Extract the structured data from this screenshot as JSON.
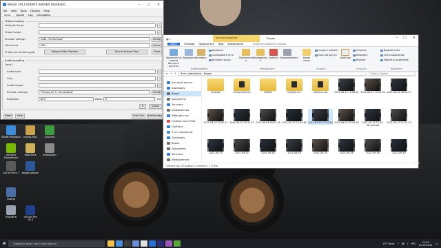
{
  "desktop_icons": [
    {
      "label": "AOMEI Partition",
      "color": "#3a8bdc"
    },
    {
      "label": "movie-files",
      "color": "#caa24b"
    },
    {
      "label": "uTorrent",
      "color": "#3f9b3f"
    },
    {
      "label": "GeForce Experience",
      "color": "#76b900"
    },
    {
      "label": "Mod-Files",
      "color": "#d0b25b"
    },
    {
      "label": "mdisplayer",
      "color": "#8a8a8a"
    },
    {
      "label": "Call of Duty 2",
      "color": "#5b5b5b"
    },
    {
      "label": "видео-ролик",
      "color": "#2b5797"
    },
    {
      "label": "Корзина",
      "color": "#9aa3ad"
    },
    {
      "label": "VEGAS Pro 18.0",
      "color": "#203f8a"
    },
    {
      "label": "ПоиНо",
      "color": "#4a6ea8"
    }
  ],
  "megui": {
    "title": "MeGUI 2913 UPDATE SERVER DISABLED",
    "menu": [
      "File",
      "View",
      "Tools",
      "Options",
      "Help"
    ],
    "tabs": [
      "Input",
      "Queue",
      "Log",
      "Changelog"
    ],
    "video_group": "Video encoding",
    "avisynth_label": "AviSynth Script",
    "video_output_label": "Video Output",
    "encoder_label": "Encoder settings",
    "encoder_value": "x264: *scratchpad*",
    "file_format_label": "File format",
    "file_format_value": "MKV",
    "add_prerender": "Add pre-rendering job",
    "reopen_btn": "Reopen Video Preview",
    "queue_btn": "Queue Analysis Pass",
    "config_btn": "Config",
    "queue_small": "Queue",
    "audio_group": "Audio encoding",
    "track_label": "Track 1",
    "audio_input_label": "Audio Input",
    "cuts_label": "Cuts",
    "audio_output_label": "Audio Output",
    "audio_encoder_value": "FFmpeg AC-3: *scratchpad*",
    "extension_label": "Extension",
    "extension_value": "AC3",
    "delay_label": "Delay",
    "delay_value": "0",
    "ms": "ms",
    "x_btn": "X",
    "reset_btn": "Reset",
    "help_btn": "Help",
    "oneclick_btn": "One-Click",
    "autoencode_btn": "AutoEncode"
  },
  "explorer": {
    "context_tab": "Воспроизведение",
    "context_title": "Средства работы с видео",
    "title": "Видео",
    "tabs": [
      "Файл",
      "Главная",
      "Поделиться",
      "Вид",
      "Управление"
    ],
    "ribbon": {
      "pin": "Закрепить на панели быстрого доступа",
      "copy": "Копировать",
      "paste": "Вставить",
      "cut": "Вырезать",
      "copy_path": "Скопировать путь",
      "paste_shortcut": "Вставить ярлык",
      "move": "Переместить в",
      "copy_to": "Копировать в",
      "delete": "Удалить",
      "rename": "Переименовать",
      "new_folder": "Новая папка",
      "new_item": "Создать элемент",
      "easy_access": "Простой доступ",
      "properties": "Свойства",
      "open": "Открыть",
      "change": "Изменить",
      "history": "Журнал",
      "select_all": "Выделить все",
      "select_none": "Снять выделение",
      "invert": "Обратить выделение",
      "g_clipboard": "Буфер обмена",
      "g_organize": "Упорядочить",
      "g_create": "Создать",
      "g_open": "Открыть",
      "g_select": "Выделить"
    },
    "address": "Этот компьютер  ›  Видео",
    "search_placeholder": "Поиск: Видео",
    "nav": [
      {
        "label": "Быстрый доступ",
        "color": "#2f7bd8"
      },
      {
        "label": "Downloads",
        "color": "#2f7bd8"
      },
      {
        "label": "Видео",
        "color": "#6d6d6d"
      },
      {
        "label": "Документы",
        "color": "#6d6d6d"
      },
      {
        "label": "Загрузки",
        "color": "#2f7bd8"
      },
      {
        "label": "Изображения",
        "color": "#6d6d6d"
      },
      {
        "label": "Рабочий стол",
        "color": "#2f7bd8"
      },
      {
        "label": "Creative Cloud Files",
        "color": "#e34850"
      },
      {
        "label": "OneDrive",
        "color": "#2f7bd8"
      },
      {
        "label": "Этот компьютер",
        "color": "#4a88c7"
      },
      {
        "label": "Downloads",
        "color": "#2f7bd8"
      },
      {
        "label": "Видео",
        "color": "#6d6d6d"
      },
      {
        "label": "Документы",
        "color": "#6d6d6d"
      },
      {
        "label": "Загрузки",
        "color": "#2f7bd8"
      },
      {
        "label": "Изображения",
        "color": "#6d6d6d"
      },
      {
        "label": "Музыка",
        "color": "#6d6d6d"
      },
      {
        "label": "Объемные объект",
        "color": "#6d6d6d"
      },
      {
        "label": "Рабочий стол",
        "color": "#2f7bd8"
      }
    ],
    "files_row1": [
      {
        "name": "AnyDesk",
        "kind": "folder"
      },
      {
        "name": "mehgcmud.xcs",
        "kind": "folder-film"
      },
      {
        "name": "NVIDIA",
        "kind": "folder"
      },
      {
        "name": "ufaej3D.vcx",
        "kind": "folder-film"
      },
      {
        "name": "reAOsnw.xac",
        "kind": "folder-film"
      },
      {
        "name": "2021-08-19 19-08-03",
        "kind": "video"
      },
      {
        "name": "2021-08-25 19-34-36",
        "kind": "video"
      },
      {
        "name": "2021-08-26 16-05-27",
        "kind": "video"
      }
    ],
    "files_row2": [
      {
        "name": "2021-08-29 22-07-21",
        "kind": "video"
      },
      {
        "name": "2021-08-30 19-13-45",
        "kind": "video"
      },
      {
        "name": "2021-09-04 18-25-18",
        "kind": "video"
      },
      {
        "name": "2021-09-13 23-43-48",
        "kind": "video"
      },
      {
        "name": "2021-09-13 23-43-48",
        "kind": "video",
        "selected": true
      },
      {
        "name": "2021-09-13 23-43-48",
        "kind": "video"
      },
      {
        "name": "2021-09-13 23-43-48.mp4.db",
        "kind": "video"
      },
      {
        "name": "2021-09-13 21-01-32",
        "kind": "video"
      }
    ],
    "files_row3": [
      {
        "name": "2021-09-15",
        "kind": "video"
      },
      {
        "name": "2021-09-15",
        "kind": "video"
      },
      {
        "name": "2021-09-16",
        "kind": "video"
      },
      {
        "name": "2021-09-16",
        "kind": "video"
      },
      {
        "name": "2021-09-16",
        "kind": "video"
      },
      {
        "name": "2021-09-16",
        "kind": "video"
      },
      {
        "name": "2021-09-16",
        "kind": "video"
      },
      {
        "name": "2021-09-16",
        "kind": "video"
      }
    ],
    "status": "Элементов: 25    Выбран 1 элемент: 710 МБ"
  },
  "taskbar": {
    "search_placeholder": "Введите здесь текст для поиска",
    "apps": [
      "#f0c24b",
      "#4a8fd8",
      "#3c3c3c",
      "#6d8fd8",
      "#e0e0e0",
      "#2a6fd8",
      "#2c2c7a",
      "#9c59b6",
      "#5aa63c"
    ],
    "weather": "8°C  Ясно",
    "lang": "РУС",
    "time": "21:40",
    "date": "21.09.2021"
  }
}
